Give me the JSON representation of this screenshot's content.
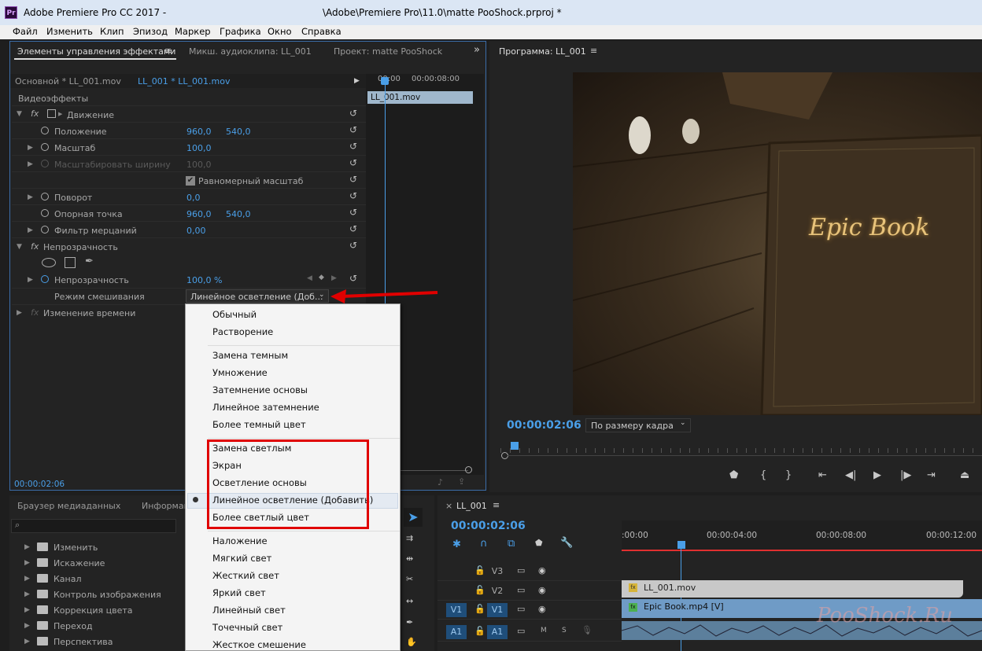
{
  "window": {
    "title": "Adobe Premiere Pro CC 2017 -",
    "path": "\\Adobe\\Premiere Pro\\11.0\\matte PooShock.prproj *",
    "logo": "Pr"
  },
  "menu": [
    "Файл",
    "Изменить",
    "Клип",
    "Эпизод",
    "Маркер",
    "Графика",
    "Окно",
    "Справка"
  ],
  "effects_panel": {
    "tabs": [
      "Элементы управления эффектами",
      "Микш. аудиоклипа: LL_001",
      "Проект: matte PooShock"
    ],
    "source_tab": "Основной * LL_001.mov",
    "sequence_tab": "LL_001 * LL_001.mov",
    "tl_time_start": "00:00",
    "tl_time_end": "00:00:08:00",
    "clip_name": "LL_001.mov",
    "section_video": "Видеоэффекты",
    "motion": "Движение",
    "position_label": "Положение",
    "position_x": "960,0",
    "position_y": "540,0",
    "scale_label": "Масштаб",
    "scale_value": "100,0",
    "scale_width_label": "Масштабировать ширину",
    "scale_width_value": "100,0",
    "uniform_label": "Равномерный масштаб",
    "rotation_label": "Поворот",
    "rotation_value": "0,0",
    "anchor_label": "Опорная точка",
    "anchor_x": "960,0",
    "anchor_y": "540,0",
    "flicker_label": "Фильтр мерцаний",
    "flicker_value": "0,00",
    "opacity_section": "Непрозрачность",
    "opacity_label": "Непрозрачность",
    "opacity_value": "100,0 %",
    "blend_label": "Режим смешивания",
    "blend_value": "Линейное осветление (Доб...",
    "time_remap": "Изменение времени",
    "timecode": "00:00:02:06"
  },
  "blend_menu": {
    "groups": [
      [
        "Обычный",
        "Растворение"
      ],
      [
        "Замена темным",
        "Умножение",
        "Затемнение основы",
        "Линейное затемнение",
        "Более темный цвет"
      ],
      [
        "Замена светлым",
        "Экран",
        "Осветление основы",
        "Линейное осветление (Добавить)",
        "Более светлый цвет"
      ],
      [
        "Наложение",
        "Мягкий свет",
        "Жесткий свет",
        "Яркий свет",
        "Линейный свет",
        "Точечный свет",
        "Жесткое смешение"
      ]
    ],
    "selected": "Линейное осветление (Добавить)"
  },
  "program": {
    "title": "Программа: LL_001",
    "timecode": "00:00:02:06",
    "fit": "По размеру кадра",
    "book_text": "Epic Book"
  },
  "media_browser": {
    "tabs": [
      "Браузер медиаданных",
      "Информац"
    ],
    "folders": [
      "Изменить",
      "Искажение",
      "Канал",
      "Контроль изображения",
      "Коррекция цвета",
      "Переход",
      "Перспектива"
    ]
  },
  "timeline": {
    "name": "LL_001",
    "timecode": "00:00:02:06",
    "ruler": [
      ":00:00",
      "00:00:04:00",
      "00:00:08:00",
      "00:00:12:00"
    ],
    "tracks": [
      {
        "src": "",
        "name": "V3"
      },
      {
        "src": "",
        "name": "V2"
      },
      {
        "src": "V1",
        "name": "V1"
      },
      {
        "src": "A1",
        "name": "A1"
      }
    ],
    "clips": [
      "LL_001.mov",
      "Epic Book.mp4 [V]"
    ],
    "m": "M",
    "s": "S"
  },
  "watermark": "PooShock.Ru",
  "colors": {
    "accent": "#4a9fe8",
    "highlight": "#e00000"
  }
}
